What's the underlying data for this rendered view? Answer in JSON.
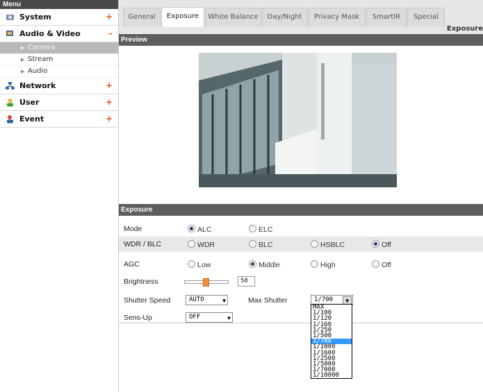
{
  "sidebar": {
    "header": "Menu",
    "sections": [
      {
        "label": "System",
        "toggle": "+"
      },
      {
        "label": "Audio & Video",
        "toggle": "–"
      },
      {
        "label": "Network",
        "toggle": "+"
      },
      {
        "label": "User",
        "toggle": "+"
      },
      {
        "label": "Event",
        "toggle": "+"
      }
    ],
    "av_items": [
      {
        "label": "Camera"
      },
      {
        "label": "Stream"
      },
      {
        "label": "Audio"
      }
    ]
  },
  "tabs": [
    "General",
    "Exposure",
    "White Balance",
    "Day/Night",
    "Privacy Mask",
    "SmartIR",
    "Special"
  ],
  "active_tab": "Exposure",
  "page_title": "Exposure",
  "preview": {
    "heading": "Preview"
  },
  "exposure": {
    "heading": "Exposure",
    "mode": {
      "label": "Mode",
      "options": [
        "ALC",
        "ELC"
      ],
      "selected": "ALC"
    },
    "wdr": {
      "label": "WDR / BLC",
      "options": [
        "WDR",
        "BLC",
        "HSBLC",
        "Off"
      ],
      "selected": "Off"
    },
    "agc": {
      "label": "AGC",
      "options": [
        "Low",
        "Middle",
        "High",
        "Off"
      ],
      "selected": "Middle"
    },
    "brightness": {
      "label": "Brightness",
      "value": "50"
    },
    "shutter_speed": {
      "label": "Shutter Speed",
      "value": "AUTO"
    },
    "max_shutter": {
      "label": "Max Shutter",
      "value": "1/700",
      "options": [
        "MAX",
        "1/100",
        "1/120",
        "1/160",
        "1/250",
        "1/500",
        "1/700",
        "1/1000",
        "1/1600",
        "1/2500",
        "1/5000",
        "1/7000",
        "1/10000"
      ]
    },
    "sens_up": {
      "label": "Sens-Up",
      "value": "OFF"
    }
  },
  "colors": {
    "accent": "#f18c3a",
    "header_bar": "#5e5e5e",
    "selected_option": "#3399ff"
  }
}
